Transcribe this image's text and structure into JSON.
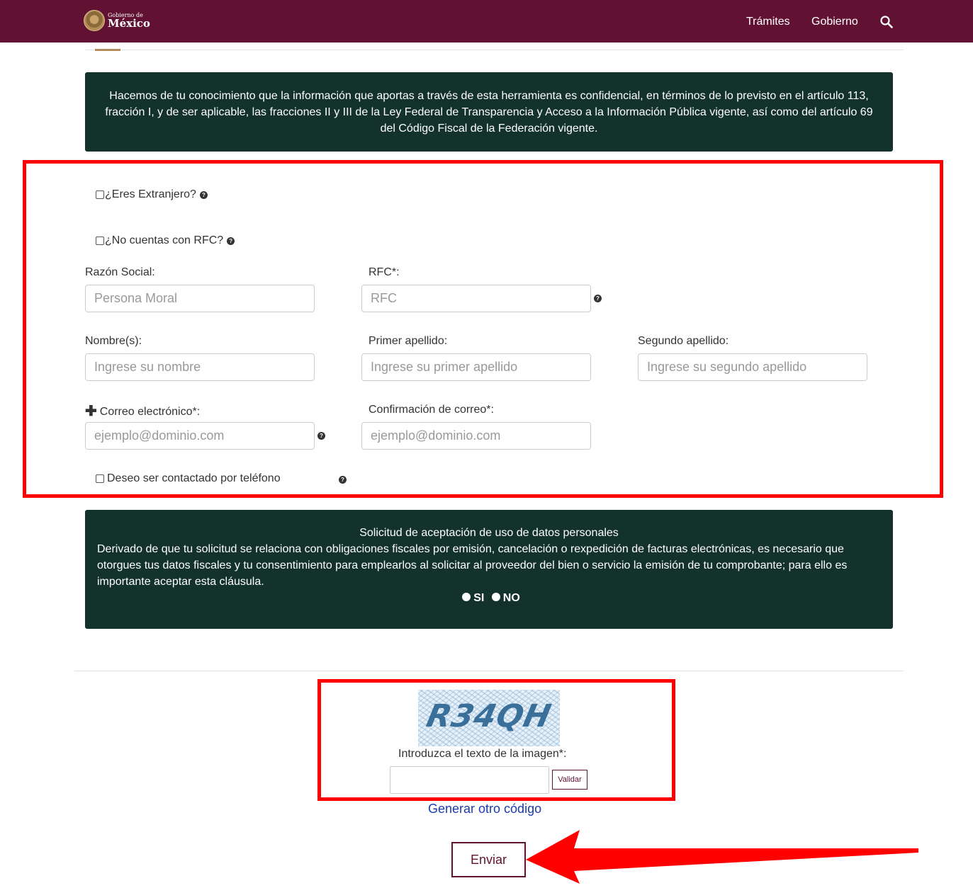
{
  "header": {
    "logo_small": "Gobierno de",
    "logo_big": "México",
    "nav": [
      "Trámites",
      "Gobierno"
    ]
  },
  "notice_confidential": "Hacemos de tu conocimiento que la información que aportas a través de esta herramienta es confidencial, en términos de lo previsto en el artículo 113, fracción I, y de ser aplicable, las fracciones II y III de la Ley Federal de Transparencia y Acceso a la Información Pública vigente, así como del artículo 69 del Código Fiscal de la Federación vigente.",
  "form": {
    "extranjero_label": "¿Eres Extranjero?",
    "no_rfc_label": "¿No cuentas con RFC?",
    "razon_social_label": "Razón Social:",
    "razon_social_placeholder": "Persona Moral",
    "rfc_label": "RFC*:",
    "rfc_placeholder": "RFC",
    "nombre_label": "Nombre(s):",
    "nombre_placeholder": "Ingrese su nombre",
    "primer_apellido_label": "Primer apellido:",
    "primer_apellido_placeholder": "Ingrese su primer apellido",
    "segundo_apellido_label": "Segundo apellido:",
    "segundo_apellido_placeholder": "Ingrese su segundo apellido",
    "correo_label": "Correo electrónico*:",
    "correo_placeholder": "ejemplo@dominio.com",
    "confirmacion_label": "Confirmación de correo*:",
    "confirmacion_placeholder": "ejemplo@dominio.com",
    "telefono_label": "Deseo ser contactado por teléfono"
  },
  "consent": {
    "title": "Solicitud de aceptación de uso de datos personales",
    "body": "Derivado de que tu solicitud se relaciona con obligaciones fiscales por emisión, cancelación o rexpedición de facturas electrónicas, es necesario que otorgues tus datos fiscales y tu consentimiento para emplearlos al solicitar al proveedor del bien o servicio la emisión de tu comprobante; para ello es importante aceptar esta cláusula.",
    "option_si": "SI",
    "option_no": "NO"
  },
  "captcha": {
    "code": "R34QH",
    "prompt": "Introduzca el texto de la imagen*:",
    "validar": "Validar",
    "regenerate": "Generar otro código"
  },
  "submit_label": "Enviar",
  "colors": {
    "brand": "#611232",
    "notice_bg": "#13322b",
    "highlight": "#ff0000",
    "link": "#1a3bb3"
  }
}
